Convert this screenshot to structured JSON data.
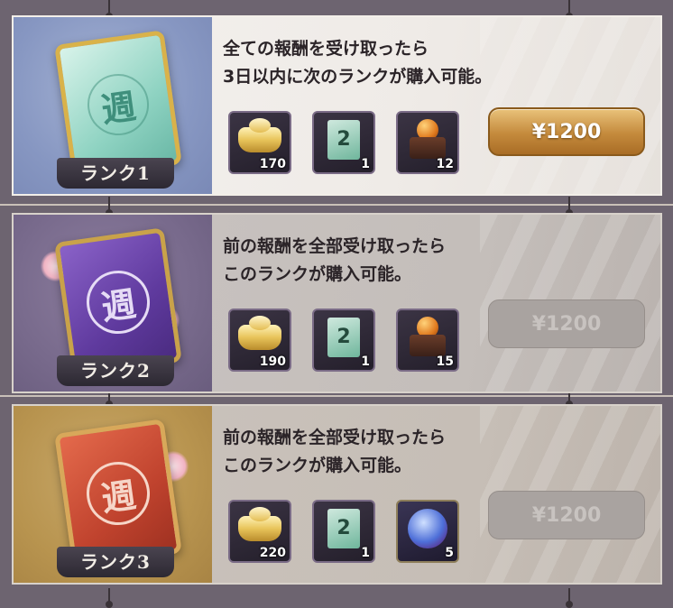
{
  "tiers": [
    {
      "rank_label": "ランク1",
      "glyph": "週",
      "desc_line1": "全ての報酬を受け取ったら",
      "desc_line2": "3日以内に次のランクが購入可能。",
      "items": [
        {
          "icon": "gold-ingot-icon",
          "qty": "170"
        },
        {
          "icon": "ticket-icon",
          "qty": "1",
          "ticket_number": "2"
        },
        {
          "icon": "orb-stand-icon",
          "qty": "12"
        }
      ],
      "price": "¥1200",
      "enabled": true
    },
    {
      "rank_label": "ランク2",
      "glyph": "週",
      "desc_line1": "前の報酬を全部受け取ったら",
      "desc_line2": "このランクが購入可能。",
      "items": [
        {
          "icon": "gold-ingot-icon",
          "qty": "190"
        },
        {
          "icon": "ticket-icon",
          "qty": "1",
          "ticket_number": "2"
        },
        {
          "icon": "orb-stand-icon",
          "qty": "15"
        }
      ],
      "price": "¥1200",
      "enabled": false
    },
    {
      "rank_label": "ランク3",
      "glyph": "週",
      "desc_line1": "前の報酬を全部受け取ったら",
      "desc_line2": "このランクが購入可能。",
      "items": [
        {
          "icon": "gold-ingot-icon",
          "qty": "220"
        },
        {
          "icon": "ticket-icon",
          "qty": "1",
          "ticket_number": "2"
        },
        {
          "icon": "crystal-icon",
          "qty": "5"
        }
      ],
      "price": "¥1200",
      "enabled": false
    }
  ]
}
